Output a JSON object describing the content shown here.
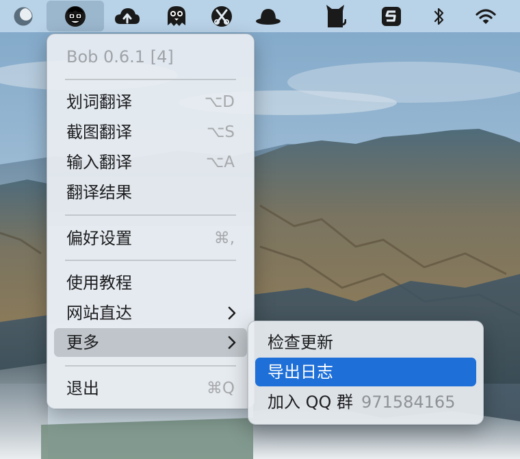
{
  "menubar": {
    "icons": [
      {
        "name": "focus-ring-icon"
      },
      {
        "name": "bob-app-icon",
        "active": true
      },
      {
        "name": "cloud-upload-icon"
      },
      {
        "name": "ghost-icon"
      },
      {
        "name": "scissors-app-icon"
      },
      {
        "name": "hat-icon"
      },
      {
        "name": "black-cat-icon"
      },
      {
        "name": "s-app-icon"
      },
      {
        "name": "bluetooth-icon"
      },
      {
        "name": "wifi-icon"
      }
    ]
  },
  "bob_menu": {
    "header": "Bob 0.6.1 [4]",
    "items": [
      {
        "label": "划词翻译",
        "shortcut": "⌥D"
      },
      {
        "label": "截图翻译",
        "shortcut": "⌥S"
      },
      {
        "label": "输入翻译",
        "shortcut": "⌥A"
      },
      {
        "label": "翻译结果",
        "shortcut": ""
      },
      {
        "label": "偏好设置",
        "shortcut": "⌘,"
      },
      {
        "label": "使用教程",
        "shortcut": ""
      },
      {
        "label": "网站直达",
        "submenu": true
      },
      {
        "label": "更多",
        "submenu": true,
        "highlighted": true
      },
      {
        "label": "退出",
        "shortcut": "⌘Q"
      }
    ]
  },
  "more_submenu": {
    "items": [
      {
        "label": "检查更新"
      },
      {
        "label": "导出日志",
        "highlighted": true
      },
      {
        "label": "加入 QQ 群",
        "value": "971584165"
      }
    ]
  },
  "colors": {
    "menubar_bg": "#c8def0",
    "menu_bg": "#e8edf1",
    "highlight_blue": "#1e6fd8",
    "shortcut_gray": "#a7a9ac"
  }
}
